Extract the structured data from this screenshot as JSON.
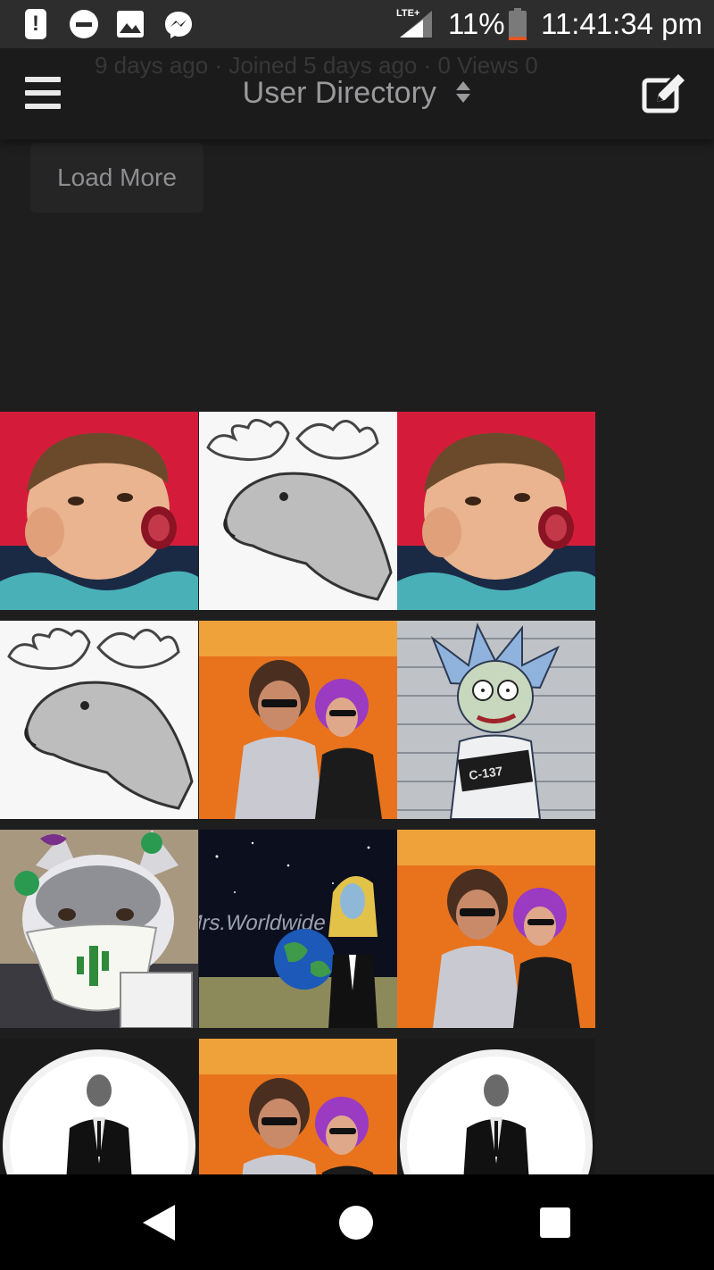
{
  "status_bar": {
    "network": "LTE+",
    "battery_percent": "11%",
    "time": "11:41:34 pm",
    "icons": [
      "alert-icon",
      "do-not-disturb-icon",
      "gallery-icon",
      "messenger-icon",
      "signal-icon",
      "battery-icon"
    ],
    "battery_level": 0.11,
    "battery_color": "#e8541f"
  },
  "header": {
    "title": "User Directory",
    "ghost_meta": "9 days ago · Joined 5 days ago · 0 Views 0",
    "menu_icon": "hamburger-menu-icon",
    "sort_icon": "sort-caret-icon",
    "compose_icon": "compose-icon"
  },
  "main": {
    "load_more_label": "Load More"
  },
  "avatar_grid": {
    "rows": [
      [
        "crying-boy",
        "moose-sketch",
        "crying-boy"
      ],
      [
        "moose-sketch",
        "retro-couple",
        "rick-mugshot"
      ],
      [
        "husky-mask",
        "mrs-worldwide",
        "retro-couple"
      ],
      [
        "bond-silhouette",
        "retro-couple",
        "bond-silhouette"
      ]
    ],
    "mugshot_text": "C-137"
  },
  "nav_bar": {
    "icons": [
      "back-icon",
      "home-icon",
      "recents-icon"
    ]
  },
  "colors": {
    "background": "#1e1e1f",
    "header": "#1b1b1c",
    "status_bar": "#2d2d2e",
    "title_text": "#9a9a9c"
  }
}
